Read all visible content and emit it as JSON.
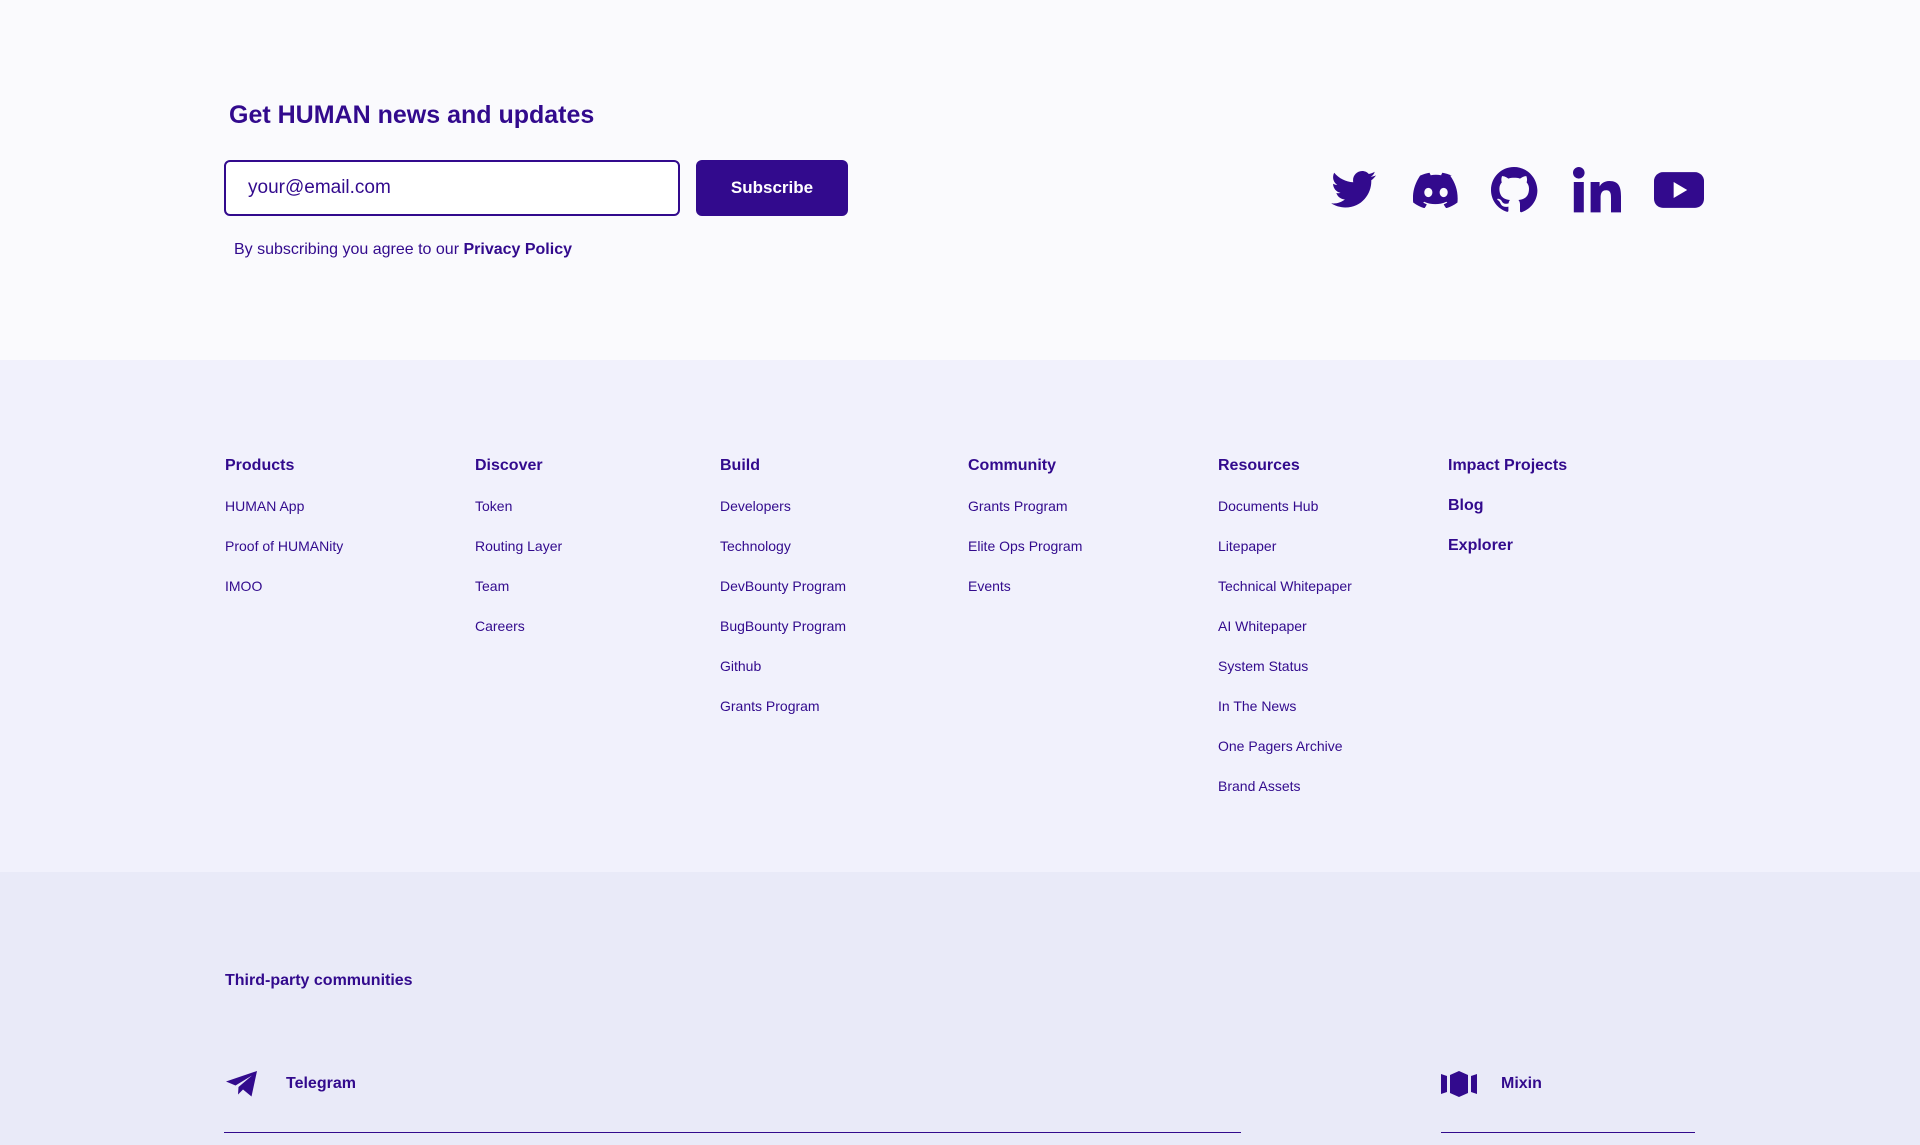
{
  "newsletter": {
    "title": "Get HUMAN news and updates",
    "email_placeholder": "your@email.com",
    "subscribe_label": "Subscribe",
    "disclaimer_prefix": "By subscribing you agree to our ",
    "privacy_link": "Privacy Policy"
  },
  "socials": [
    {
      "name": "Twitter",
      "icon": "twitter-icon"
    },
    {
      "name": "Discord",
      "icon": "discord-icon"
    },
    {
      "name": "GitHub",
      "icon": "github-icon"
    },
    {
      "name": "LinkedIn",
      "icon": "linkedin-icon"
    },
    {
      "name": "YouTube",
      "icon": "youtube-icon"
    }
  ],
  "columns": {
    "products": {
      "heading": "Products",
      "links": [
        "HUMAN App",
        "Proof of HUMANity",
        "IMOO"
      ]
    },
    "discover": {
      "heading": "Discover",
      "links": [
        "Token",
        "Routing Layer",
        "Team",
        "Careers"
      ]
    },
    "build": {
      "heading": "Build",
      "links": [
        "Developers",
        "Technology",
        "DevBounty Program",
        "BugBounty Program",
        "Github",
        "Grants Program"
      ]
    },
    "community": {
      "heading": "Community",
      "links": [
        "Grants Program",
        "Elite Ops Program",
        "Events"
      ]
    },
    "resources": {
      "heading": "Resources",
      "links": [
        "Documents Hub",
        "Litepaper",
        "Technical Whitepaper",
        "AI Whitepaper",
        "System Status",
        "In The News",
        "One Pagers Archive",
        "Brand Assets"
      ]
    },
    "extra": {
      "links": [
        "Impact Projects",
        "Blog",
        "Explorer"
      ]
    }
  },
  "third_party": {
    "title": "Third-party communities",
    "items": [
      {
        "label": "Telegram",
        "icon": "telegram-icon"
      },
      {
        "label": "Mixin",
        "icon": "mixin-icon"
      }
    ]
  },
  "colors": {
    "brand": "#320a8d",
    "newsletter_bg": "#fafafd",
    "links_bg": "#f1f1fc",
    "third_party_bg": "#e9eaf8"
  }
}
